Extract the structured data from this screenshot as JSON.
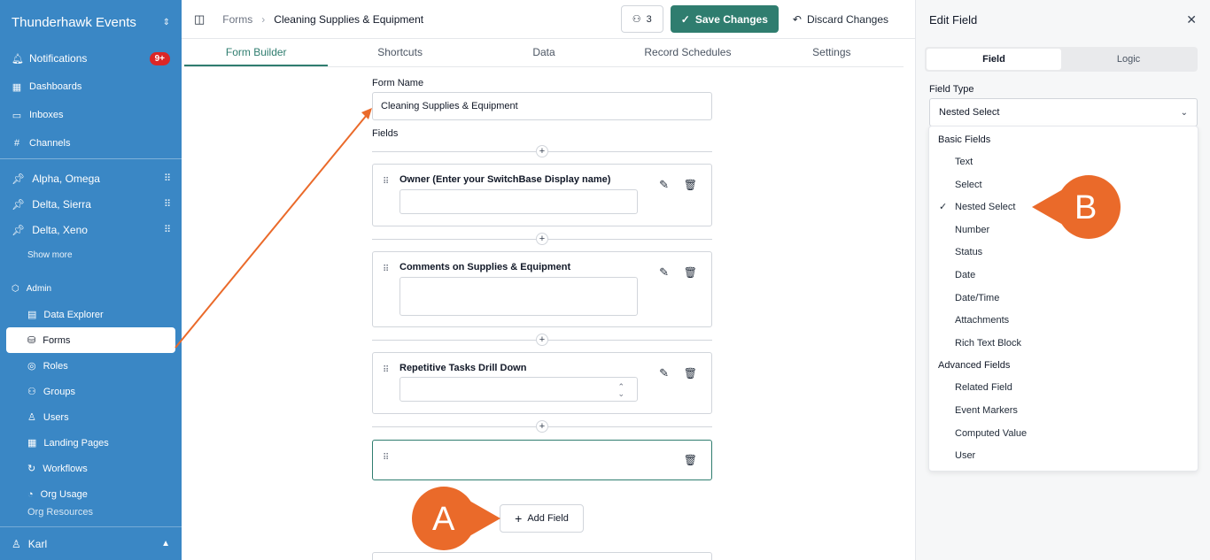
{
  "sidebar": {
    "workspace": "Thunderhawk Events",
    "nav": [
      {
        "label": "Notifications",
        "icon": "bell-icon",
        "badge": "9+"
      },
      {
        "label": "Dashboards",
        "icon": "dashboard-icon"
      },
      {
        "label": "Inboxes",
        "icon": "inbox-icon"
      },
      {
        "label": "Channels",
        "icon": "hash-icon"
      }
    ],
    "pinned": [
      {
        "label": "Alpha, Omega",
        "icon": "pin-icon"
      },
      {
        "label": "Delta, Sierra",
        "icon": "pin-icon"
      },
      {
        "label": "Delta, Xeno",
        "icon": "pin-icon"
      }
    ],
    "show_more": "Show more",
    "admin_label": "Admin",
    "admin_items": [
      {
        "label": "Data Explorer",
        "icon": "table-icon"
      },
      {
        "label": "Forms",
        "icon": "database-icon",
        "active": true
      },
      {
        "label": "Roles",
        "icon": "check-circle-icon"
      },
      {
        "label": "Groups",
        "icon": "users-icon"
      },
      {
        "label": "Users",
        "icon": "user-icon"
      },
      {
        "label": "Landing Pages",
        "icon": "grid-icon"
      },
      {
        "label": "Workflows",
        "icon": "workflow-icon"
      },
      {
        "label": "Org Usage",
        "icon": "gauge-icon"
      }
    ],
    "cut_off_item": "Org Resources",
    "user": "Karl"
  },
  "topbar": {
    "crumb_root": "Forms",
    "crumb_current": "Cleaning Supplies & Equipment",
    "members_count": "3",
    "save_label": "Save Changes",
    "discard_label": "Discard Changes"
  },
  "tabs": [
    "Form Builder",
    "Shortcuts",
    "Data",
    "Record Schedules",
    "Settings"
  ],
  "form": {
    "name_label": "Form Name",
    "name_value": "Cleaning Supplies & Equipment",
    "fields_label": "Fields",
    "fields": [
      {
        "name": "Owner (Enter your SwitchBase Display name)"
      },
      {
        "name": "Comments on Supplies & Equipment"
      },
      {
        "name": "Repetitive Tasks Drill Down"
      },
      {
        "name": ""
      }
    ],
    "add_field_label": "Add Field"
  },
  "panel": {
    "title": "Edit Field",
    "seg_field": "Field",
    "seg_logic": "Logic",
    "field_type_label": "Field Type",
    "field_type_value": "Nested Select",
    "groups": [
      {
        "label": "Basic Fields",
        "options": [
          "Text",
          "Select",
          "Nested Select",
          "Number",
          "Status",
          "Date",
          "Date/Time",
          "Attachments",
          "Rich Text Block"
        ]
      },
      {
        "label": "Advanced Fields",
        "options": [
          "Related Field",
          "Event Markers",
          "Computed Value",
          "User"
        ]
      }
    ],
    "selected_option": "Nested Select"
  },
  "annotations": {
    "callout_a": "A",
    "callout_b": "B",
    "color": "#ea6a2a"
  },
  "colors": {
    "sidebar": "#3a87c5",
    "accent": "#2f7d6f",
    "badge": "#dc2626"
  }
}
